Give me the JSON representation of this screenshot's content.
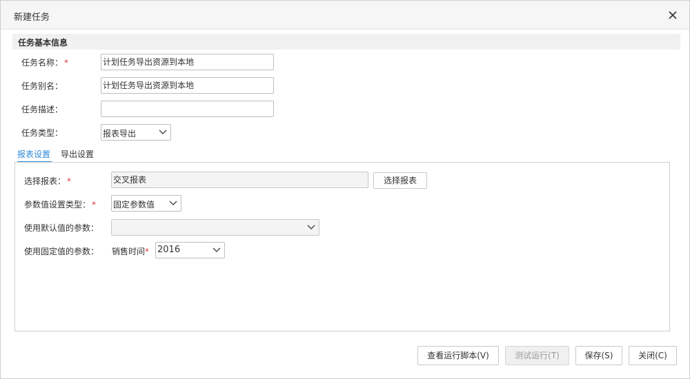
{
  "dialog": {
    "title": "新建任务",
    "close_icon": "close-icon"
  },
  "basic_info": {
    "section_title": "任务基本信息",
    "task_name": {
      "label": "任务名称：",
      "required": "*",
      "value": "计划任务导出资源到本地"
    },
    "task_alias": {
      "label": "任务别名：",
      "value": "计划任务导出资源到本地"
    },
    "task_desc": {
      "label": "任务描述：",
      "value": ""
    },
    "task_type": {
      "label": "任务类型：",
      "value": "报表导出"
    }
  },
  "tabs": [
    {
      "label": "报表设置",
      "active": true
    },
    {
      "label": "导出设置",
      "active": false
    }
  ],
  "report_settings": {
    "select_report": {
      "label": "选择报表：",
      "required": "*",
      "value": "交叉报表",
      "button_label": "选择报表"
    },
    "param_type": {
      "label": "参数值设置类型：",
      "required": "*",
      "value": "固定参数值"
    },
    "default_params": {
      "label": "使用默认值的参数：",
      "value": ""
    },
    "fixed_params": {
      "label": "使用固定值的参数：",
      "param_name": "销售时间",
      "required": "*",
      "value": "2016"
    }
  },
  "footer": {
    "view_script": "查看运行脚本(V)",
    "test_run": "测试运行(T)",
    "save": "保存(S)",
    "close": "关闭(C)"
  },
  "colors": {
    "accent": "#2f8bd8",
    "required": "#e23b3b",
    "header_bg": "#f6f6f6"
  }
}
